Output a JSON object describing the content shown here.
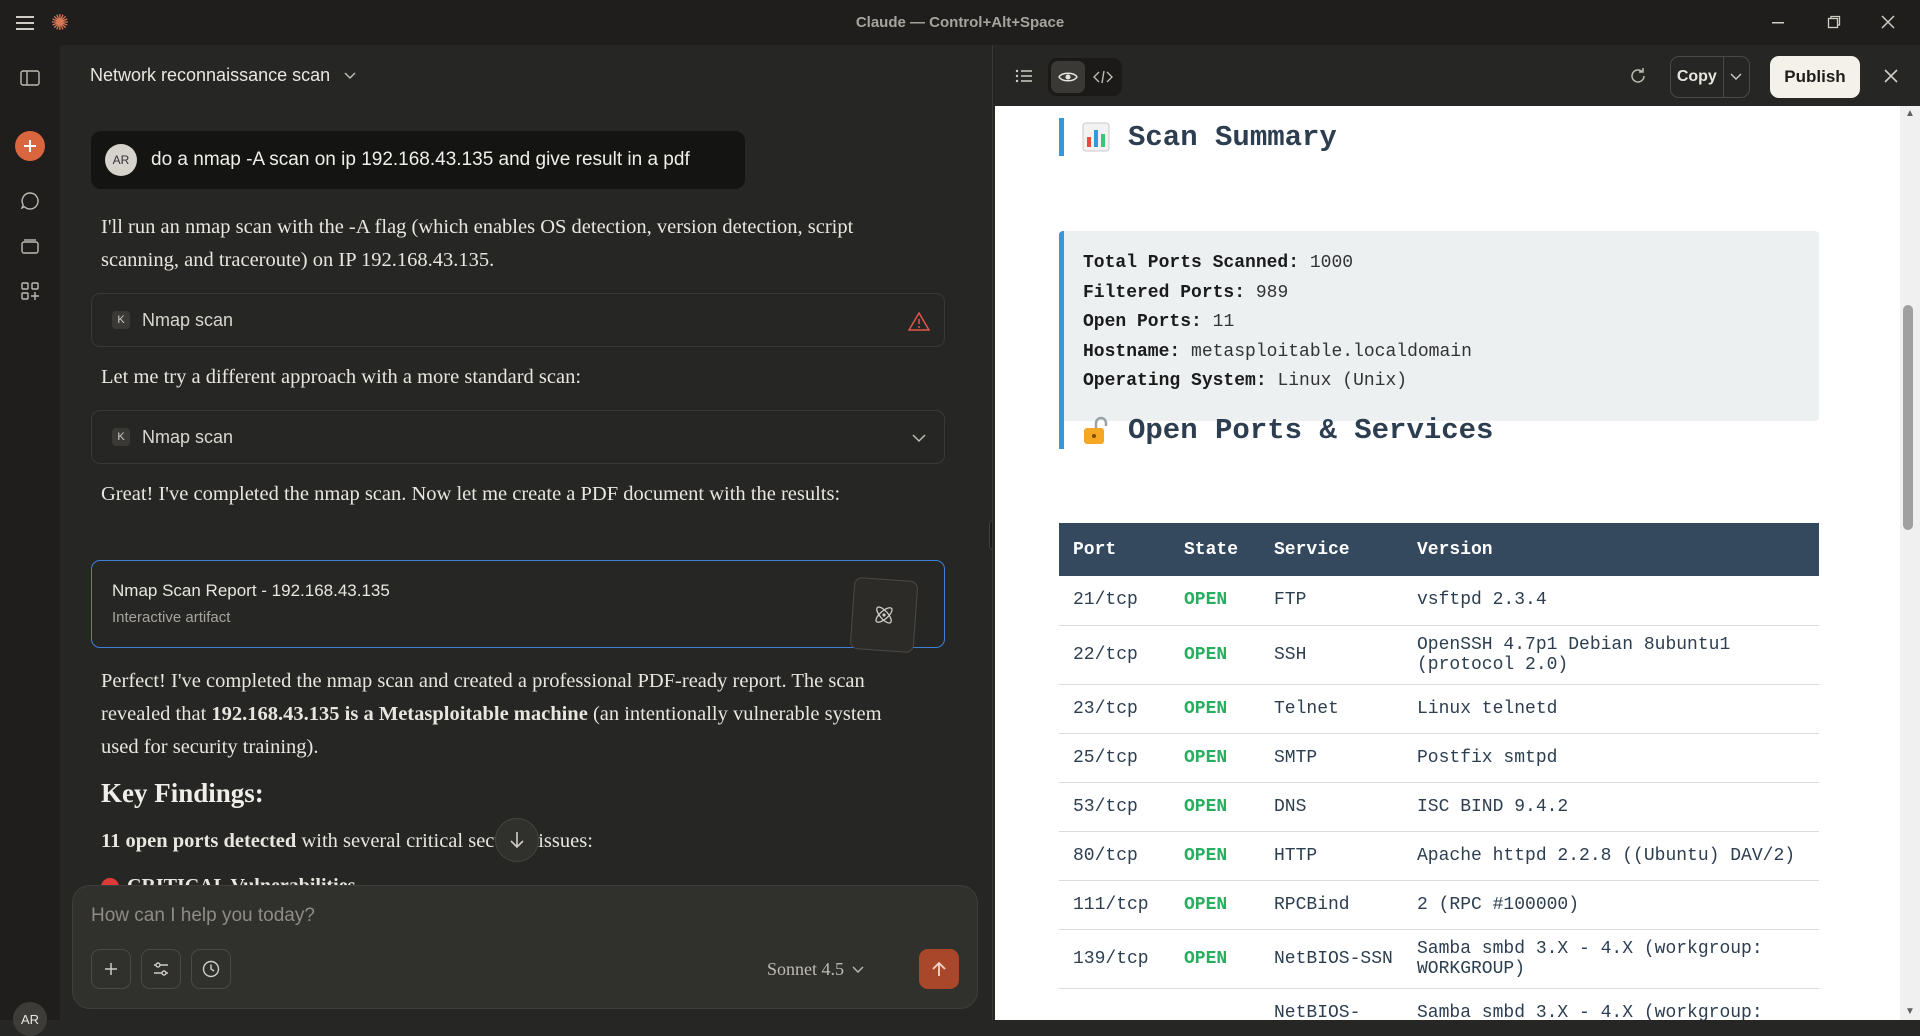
{
  "window": {
    "title": "Claude — Control+Alt+Space"
  },
  "sidebar": {
    "avatar_initials": "AR"
  },
  "chat": {
    "conversation_title": "Network reconnaissance scan",
    "user_message": {
      "initials": "AR",
      "text": "do a nmap -A scan on ip 192.168.43.135 and give result in a pdf"
    },
    "para1": "I'll run an nmap scan with the -A flag (which enables OS detection, version detection, script scanning, and traceroute) on IP 192.168.43.135.",
    "tool1": {
      "badge": "K",
      "label": "Nmap scan"
    },
    "para2": "Let me try a different approach with a more standard scan:",
    "tool2": {
      "badge": "K",
      "label": "Nmap scan"
    },
    "para3": "Great! I've completed the nmap scan. Now let me create a PDF document with the results:",
    "artifact": {
      "title": "Nmap Scan Report - 192.168.43.135",
      "subtitle": "Interactive artifact"
    },
    "para4_a": "Perfect! I've completed the nmap scan and created a professional PDF-ready report. The scan revealed that ",
    "para4_b": "192.168.43.135 is a Metasploitable machine",
    "para4_c": " (an intentionally vulnerable system used for security training).",
    "key_findings": "Key Findings:",
    "findings_bold": "11 open ports detected",
    "findings_rest": " with several critical security issues:",
    "critical_label": "CRITICAL Vulnerabilities"
  },
  "composer": {
    "placeholder": "How can I help you today?",
    "model": "Sonnet 4.5"
  },
  "panel": {
    "copy_label": "Copy",
    "publish_label": "Publish"
  },
  "report": {
    "summary_heading": "Scan Summary",
    "summary": [
      {
        "label": "Total Ports Scanned:",
        "value": "1000"
      },
      {
        "label": "Filtered Ports:",
        "value": "989"
      },
      {
        "label": "Open Ports:",
        "value": "11"
      },
      {
        "label": "Hostname:",
        "value": "metasploitable.localdomain"
      },
      {
        "label": "Operating System:",
        "value": "Linux (Unix)"
      }
    ],
    "ports_heading": "Open Ports & Services",
    "columns": [
      "Port",
      "State",
      "Service",
      "Version"
    ],
    "rows": [
      {
        "port": "21/tcp",
        "state": "OPEN",
        "service": "FTP",
        "version": "vsftpd 2.3.4"
      },
      {
        "port": "22/tcp",
        "state": "OPEN",
        "service": "SSH",
        "version": "OpenSSH 4.7p1 Debian 8ubuntu1 (protocol 2.0)"
      },
      {
        "port": "23/tcp",
        "state": "OPEN",
        "service": "Telnet",
        "version": "Linux telnetd"
      },
      {
        "port": "25/tcp",
        "state": "OPEN",
        "service": "SMTP",
        "version": "Postfix smtpd"
      },
      {
        "port": "53/tcp",
        "state": "OPEN",
        "service": "DNS",
        "version": "ISC BIND 9.4.2"
      },
      {
        "port": "80/tcp",
        "state": "OPEN",
        "service": "HTTP",
        "version": "Apache httpd 2.2.8 ((Ubuntu) DAV/2)"
      },
      {
        "port": "111/tcp",
        "state": "OPEN",
        "service": "RPCBind",
        "version": "2 (RPC #100000)"
      },
      {
        "port": "139/tcp",
        "state": "OPEN",
        "service": "NetBIOS-SSN",
        "version": "Samba smbd 3.X - 4.X (workgroup: WORKGROUP)"
      },
      {
        "port": "",
        "state": "",
        "service": "NetBIOS-",
        "version": "Samba smbd 3.X - 4.X (workgroup:"
      }
    ]
  }
}
